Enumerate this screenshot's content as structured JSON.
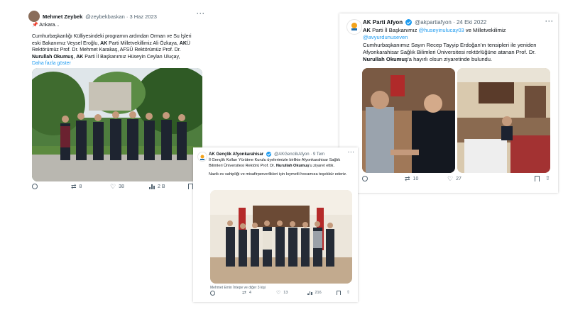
{
  "tweet1": {
    "author_name": "Mehmet Zeybek",
    "handle_date": "@zeybekbaskan · 3 Haz 2023",
    "line1": "📌 Ankara...",
    "body_part1": "Cumhurbaşkanlığı Külliyesindeki programın ardından Orman ve Su İşleri eski Bakanımız Veysel Eroğlu, ",
    "body_bold1": "AK",
    "body_part2": " Parti Milletvekillimiz Ali Özkaya, ",
    "body_bold2": "AK",
    "body_part3": "Ü Rektörümüz Prof. Dr. Mehmet Karakaş, AFSÜ Rektörümüz Prof. Dr. ",
    "body_bold3": "Nurullah Okumuş",
    "body_part4": ", ",
    "body_bold4": "AK",
    "body_part5": " Parti İl Başkanımız Hüseyin Ceylan Uluçay,",
    "show_more": "Daha fazla göster",
    "retweets": "8",
    "likes": "38",
    "views": "2 B"
  },
  "tweet2": {
    "author_name": "AK Parti Afyon",
    "handle_date": "@akpartiafyon · 24 Eki 2022",
    "line1_bold": "AK",
    "line1_text": " Parti İl Başkanımız ",
    "mention1": "@huseyinulucay03",
    "line1_rest": " ve Milletvekilimiz",
    "mention2": "@avyurdunuseven",
    "body_text": "Cumhurbaşkanımız Sayın Recep Tayyip Erdoğan'ın tensipleri ile yeniden Afyonkarahisar Sağlık Bilimleri Üniversitesi rektörlüğüne atanan Prof. Dr. ",
    "body_bold": "Nurullah Okumuş",
    "body_end": "'a hayırlı olsun ziyaretinde bulundu.",
    "retweets": "10",
    "likes": "27"
  },
  "tweet3": {
    "author_name": "AK Gençlik Afyonkarahisar",
    "handle_date": "@AKGenclikAfyon · 9 Tem",
    "body_text": "İl Gençlik Kolları Yürütme Kurulu üyelerimizle birlikte Afyonkarahisar Sağlık Bilimleri Üniversitesi Rektörü Prof. Dr. ",
    "body_bold": "Nurullah Okumuş",
    "body_end": "'u ziyaret ettik.",
    "body2": "Nazik ev sahipliği ve misafirperverlikleri için kıymetli hocamıza teşekkür ederiz.",
    "tag_line": "Mehmet Emin İntepe ve diğer 3 kişi",
    "retweets": "4",
    "likes": "13",
    "views": "216"
  },
  "icons": [
    "reply-icon",
    "retweet-icon",
    "heart-icon",
    "views-icon",
    "bookmark-icon",
    "share-icon",
    "pin-icon",
    "more-icon",
    "verified-icon"
  ],
  "colors": {
    "link": "#1d9bf0",
    "muted": "#536471",
    "text": "#0f1419"
  }
}
